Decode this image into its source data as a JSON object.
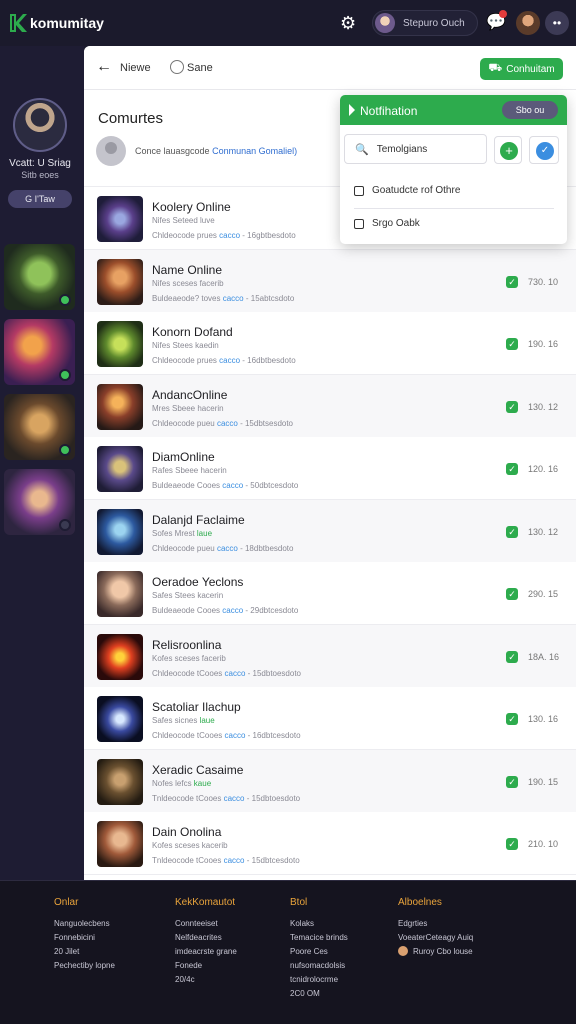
{
  "app": {
    "logo_text": "komumitay",
    "search_label": "Stepuro Ouch",
    "more_label": "••"
  },
  "sidebar": {
    "profile_name": "Vcatt: U Sriag",
    "profile_sub": "Sitb eoes",
    "profile_button": "G I'Taw"
  },
  "subbar": {
    "back_label": "Niewe",
    "save_label": "Sane",
    "community_button": "Conhuitam"
  },
  "section": {
    "title": "Comurtes",
    "header_text": "Conce lauasgcode",
    "header_link": "Conmunan Gomaliel)"
  },
  "popup": {
    "title": "Notfihation",
    "pill": "Sbo ou",
    "search_text": "Temolgians",
    "items": [
      "Goatudcte rof Othre",
      "Srgo Oabk"
    ]
  },
  "rows": [
    {
      "title": "Koolery Online",
      "sub": "Nifes Seteed luve",
      "sub_hl": "",
      "meta_a": "Chldeocode prues",
      "meta_link": "cacco",
      "meta_b": "- 16gbtbesdoto",
      "num": ""
    },
    {
      "title": "Name Online",
      "sub": "Nifes sceses facerib",
      "sub_hl": "",
      "meta_a": "Buldeaeode? toves",
      "meta_link": "cacco",
      "meta_b": "- 15abtcsdoto",
      "num": "730. 10"
    },
    {
      "title": "Konorn Dofand",
      "sub": "Nifes Stees kaedin",
      "sub_hl": "",
      "meta_a": "Chldeocode prues",
      "meta_link": "cacco",
      "meta_b": "- 16dbtbesdoto",
      "num": "190. 16"
    },
    {
      "title": "AndancOnline",
      "sub": "Mres Sbeee hacerin",
      "sub_hl": "",
      "meta_a": "Chldeocode pueu",
      "meta_link": "cacco",
      "meta_b": "- 15dbtsesdoto",
      "num": "130. 12"
    },
    {
      "title": "DiamOnline",
      "sub": "Rafes Sbeee hacerin",
      "sub_hl": "",
      "meta_a": "Buldeaeode Cooes",
      "meta_link": "cacco",
      "meta_b": "- 50dbtcesdoto",
      "num": "120. 16"
    },
    {
      "title": "Dalanjd Faclaime",
      "sub": "Sofes Mrest",
      "sub_hl": "laue",
      "meta_a": "Chldeocode pueu",
      "meta_link": "cacco",
      "meta_b": "- 18dbtbesdoto",
      "num": "130. 12"
    },
    {
      "title": "Oeradoe Yeclons",
      "sub": "Safes Stees kacerin",
      "sub_hl": "",
      "meta_a": "Buldeaeode Cooes",
      "meta_link": "cacco",
      "meta_b": "- 29dbtcesdoto",
      "num": "290. 15"
    },
    {
      "title": "Relisroonlina",
      "sub": "Kofes sceses facerib",
      "sub_hl": "",
      "meta_a": "Chldeocode tCooes",
      "meta_link": "cacco",
      "meta_b": "- 15dbtoesdoto",
      "num": "18A. 16"
    },
    {
      "title": "Scatoliar Ilachup",
      "sub": "Safes sicnes",
      "sub_hl": "laue",
      "meta_a": "Chldeocode tCooes",
      "meta_link": "cacco",
      "meta_b": "- 16dbtcesdoto",
      "num": "130. 16"
    },
    {
      "title": "Xeradic Casaime",
      "sub": "Nofes lefcs",
      "sub_hl": "kaue",
      "meta_a": "Tnldeocode tCooes",
      "meta_link": "cacco",
      "meta_b": "- 15dbtoesdoto",
      "num": "190. 15"
    },
    {
      "title": "Dain Onolina",
      "sub": "Kofes sceses kacerib",
      "sub_hl": "",
      "meta_a": "Tnldeocode tCooes",
      "meta_link": "cacco",
      "meta_b": "- 15dbtcesdoto",
      "num": "210. 10"
    }
  ],
  "footer": {
    "columns": [
      {
        "head": "Onlar",
        "lines": [
          "Nanguolecbens",
          "Fonnebicini",
          "20 Jilet",
          "Pechectiby lopne"
        ]
      },
      {
        "head": "KekKomautot",
        "lines": [
          "Connteeiset",
          "Nelfdeacrites",
          "imdeacrste grane",
          "Fonede",
          "20/4c"
        ]
      },
      {
        "head": "Btol",
        "lines": [
          "Kolaks",
          "Temacice brinds",
          "Poore Ces",
          "nufsomacdolsis",
          "tcnidrolocrme",
          "2C0 OM"
        ]
      },
      {
        "head": "Alboelnes",
        "lines": [
          "Edgrties",
          "VoeaterCeteagy Auiq",
          "Ruroy Cbo louse"
        ]
      }
    ]
  },
  "colors": {
    "accent": "#2dab4d",
    "link": "#3b8ee0",
    "footer_head": "#e8a33b",
    "sidebar_bg": "#1e1c33"
  }
}
